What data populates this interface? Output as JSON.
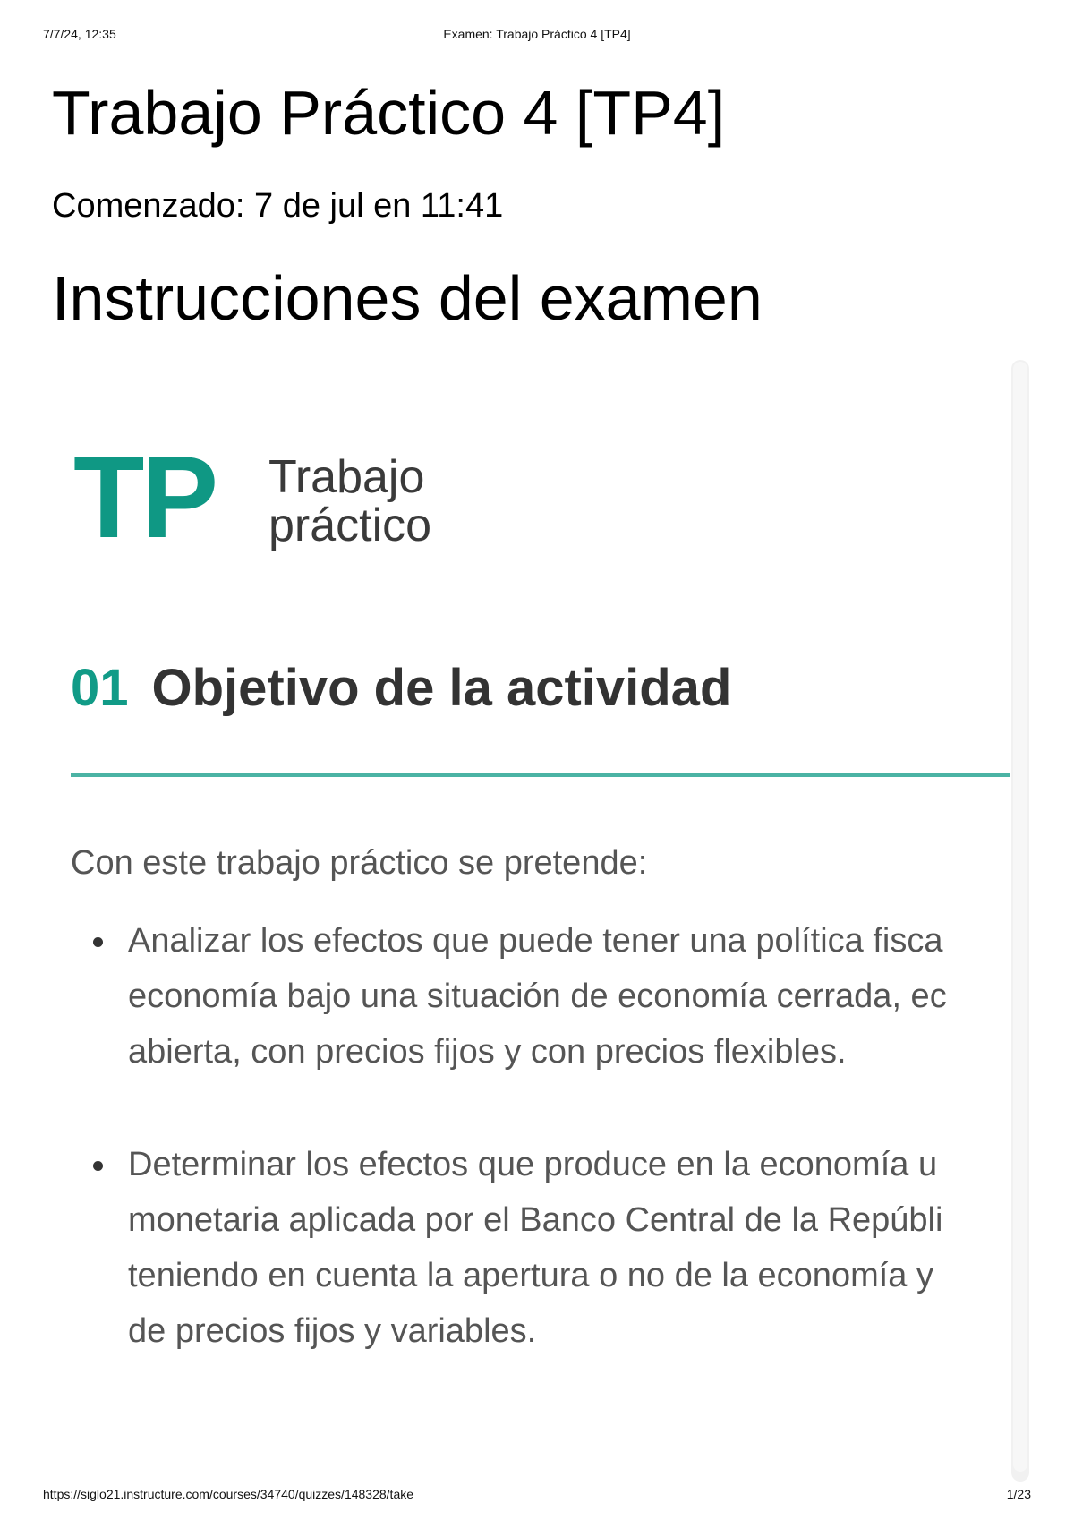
{
  "print_header": {
    "date": "7/7/24, 12:35",
    "title": "Examen: Trabajo Práctico 4 [TP4]"
  },
  "quiz": {
    "title": "Trabajo Práctico 4 [TP4]",
    "started": "Comenzado: 7 de jul en 11:41",
    "instructions_title": "Instrucciones del examen"
  },
  "content": {
    "logo": {
      "mark": "TP",
      "line1": "Trabajo",
      "line2": "práctico"
    },
    "section": {
      "number": "01",
      "title": "Objetivo de la actividad"
    },
    "intro": "Con este trabajo práctico se pretende:",
    "objectives": [
      {
        "lines": [
          "Analizar los efectos que puede tener una política fisca",
          "economía bajo una situación de economía cerrada, ec",
          "abierta, con precios fijos y con precios flexibles."
        ]
      },
      {
        "lines": [
          "Determinar los efectos que produce en la economía u",
          "monetaria aplicada por el Banco Central de la Repúbli",
          "teniendo en cuenta la apertura o no de la economía y",
          "de precios fijos y variables."
        ]
      }
    ]
  },
  "print_footer": {
    "url": "https://siglo21.instructure.com/courses/34740/quizzes/148328/take",
    "page": "1/23"
  },
  "colors": {
    "brand_teal": "#0f9884",
    "rule_teal": "#4bb3a4",
    "body_text": "#555555"
  }
}
